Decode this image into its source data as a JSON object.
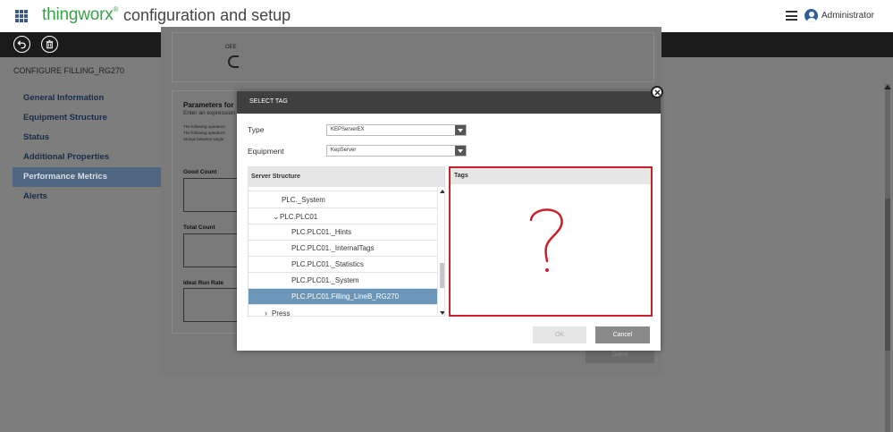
{
  "header": {
    "brand": "thingworx",
    "brand_mark": "®",
    "title": "configuration and setup",
    "user": "Administrator"
  },
  "page": {
    "title": "CONFIGURE FILLING_RG270",
    "nav": [
      {
        "label": "General Information"
      },
      {
        "label": "Equipment Structure"
      },
      {
        "label": "Status"
      },
      {
        "label": "Additional Properties"
      },
      {
        "label": "Performance Metrics",
        "active": true
      },
      {
        "label": "Alerts"
      }
    ],
    "oee_label": "OEE",
    "params_title": "Parameters for",
    "params_sub": "Enter an expression",
    "params_notes": [
      "The following operators",
      "The following operators",
      "Strings between single"
    ],
    "fields": [
      "Good Count",
      "Total Count",
      "Ideal Run Rate"
    ],
    "save_label": "Save"
  },
  "modal": {
    "title": "SELECT TAG",
    "type_label": "Type",
    "type_value": "KEPServerEX",
    "equipment_label": "Equipment",
    "equipment_value": "KepServer",
    "tree_header": "Server Structure",
    "tree_rows": [
      {
        "label": "PLC._System"
      },
      {
        "label": "PLC.PLC01",
        "expanded": true
      },
      {
        "label": "PLC.PLC01._Hints"
      },
      {
        "label": "PLC.PLC01._InternalTags"
      },
      {
        "label": "PLC.PLC01._Statistics"
      },
      {
        "label": "PLC.PLC01._System"
      },
      {
        "label": "PLC.PLC01.Filling_LineB_RG270",
        "selected": true
      },
      {
        "label": "Press",
        "collapsed": true
      }
    ],
    "tags_header": "Tags",
    "annotation": "?",
    "ok_label": "OK",
    "cancel_label": "Cancel"
  },
  "colors": {
    "brand": "#3aa04a",
    "toolbar": "#1b1b1b",
    "selected_row": "#6d97b8",
    "highlight_border": "#c8212b",
    "nav_active": "#4e6680"
  }
}
